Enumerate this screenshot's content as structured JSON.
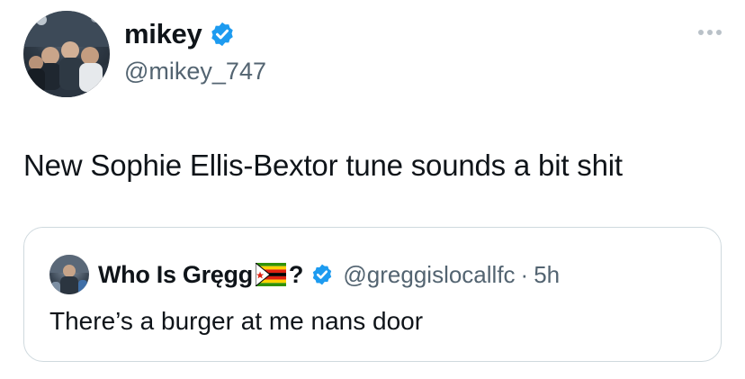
{
  "author": {
    "display_name": "mikey",
    "handle": "@mikey_747",
    "verified": true,
    "avatar": "group-photo-avatar"
  },
  "tweet": {
    "text": "New Sophie Ellis-Bextor tune sounds a bit shit"
  },
  "menu": {
    "icon": "more-options-icon"
  },
  "quoted_tweet": {
    "display_name": "Who Is Gręgg",
    "flag": "zimbabwe-flag-icon",
    "name_suffix": "?",
    "verified": true,
    "handle": "@greggislocallfc",
    "separator": "·",
    "time": "5h",
    "text": "There’s a burger at me nans door"
  },
  "colors": {
    "text": "#0f1419",
    "secondary_text": "#536471",
    "verified_blue": "#1d9bf0",
    "border": "#cfd9de"
  }
}
